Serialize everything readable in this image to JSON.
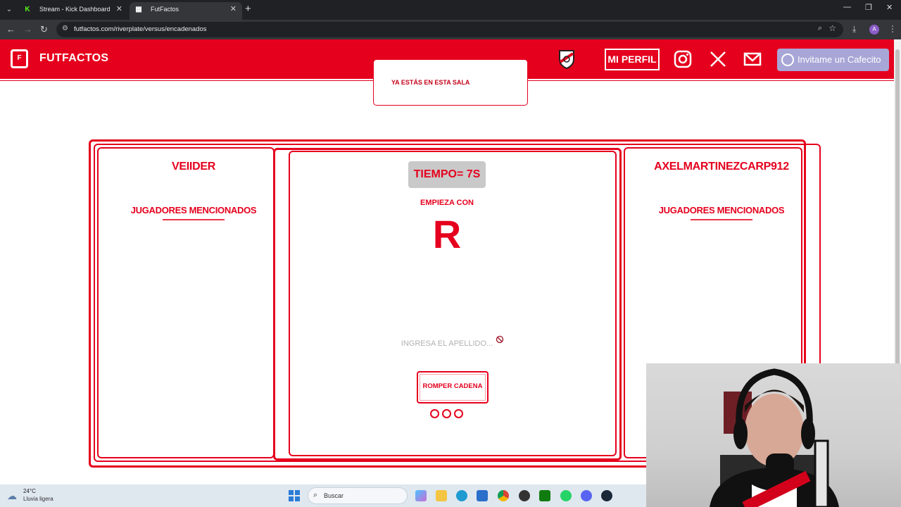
{
  "browser": {
    "tabs": [
      {
        "title": "Stream - Kick Dashboard",
        "icon": "kick-icon",
        "active": false
      },
      {
        "title": "FutFactos",
        "icon": "futfactos-icon",
        "active": true
      }
    ],
    "url": "futfactos.com/riverplate/versus/encadenados"
  },
  "header": {
    "brand": "FUTFACTOS",
    "profile_label": "MI PERFIL",
    "cafecito_label": "Invitame un Cafecito",
    "accent": "#e5001d"
  },
  "toast": {
    "message": "YA ESTÁS EN ESTA SALA"
  },
  "game": {
    "left_player": {
      "name": "VEIIDER",
      "subtitle": "JUGADORES MENCIONADOS"
    },
    "right_player": {
      "name": "AXELMARTINEZCARP912",
      "subtitle": "JUGADORES MENCIONADOS"
    },
    "timer": "TIEMPO= 7S",
    "starts_with_label": "EMPIEZA CON",
    "letter": "R",
    "input_placeholder": "INGRESA EL APELLIDO...",
    "break_button": "ROMPER CADENA",
    "lives": 3
  },
  "taskbar": {
    "temperature": "24°C",
    "weather": "Lluvia ligera",
    "search_label": "Buscar"
  }
}
